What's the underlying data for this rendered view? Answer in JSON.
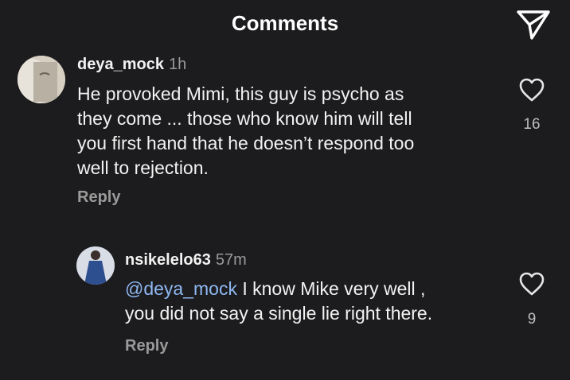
{
  "header": {
    "title": "Comments",
    "share_icon": "paper-plane-icon"
  },
  "comments": [
    {
      "username": "deya_mock",
      "time": "1h",
      "text": "He provoked Mimi, this guy is psycho as they come ... those who know him will tell you first hand that he doesn’t respond too well to rejection.",
      "lines": [
        "He provoked Mimi, this guy is psycho as",
        "they come ... those who know him will tell",
        "you first hand that he doesn’t respond too",
        "well to rejection."
      ],
      "reply_label": "Reply",
      "likes": "16",
      "like_icon": "heart-icon"
    },
    {
      "username": "nsikelelo63",
      "time": "57m",
      "mention": "@deya_mock",
      "line1_rest": " I know Mike very well ,",
      "line2": "you did not say a single lie right there.",
      "reply_label": "Reply",
      "likes": "9",
      "like_icon": "heart-icon"
    }
  ],
  "colors": {
    "background": "#1c1c1e",
    "mention": "#8fb8f2",
    "secondary_text": "#9a9a9a"
  }
}
